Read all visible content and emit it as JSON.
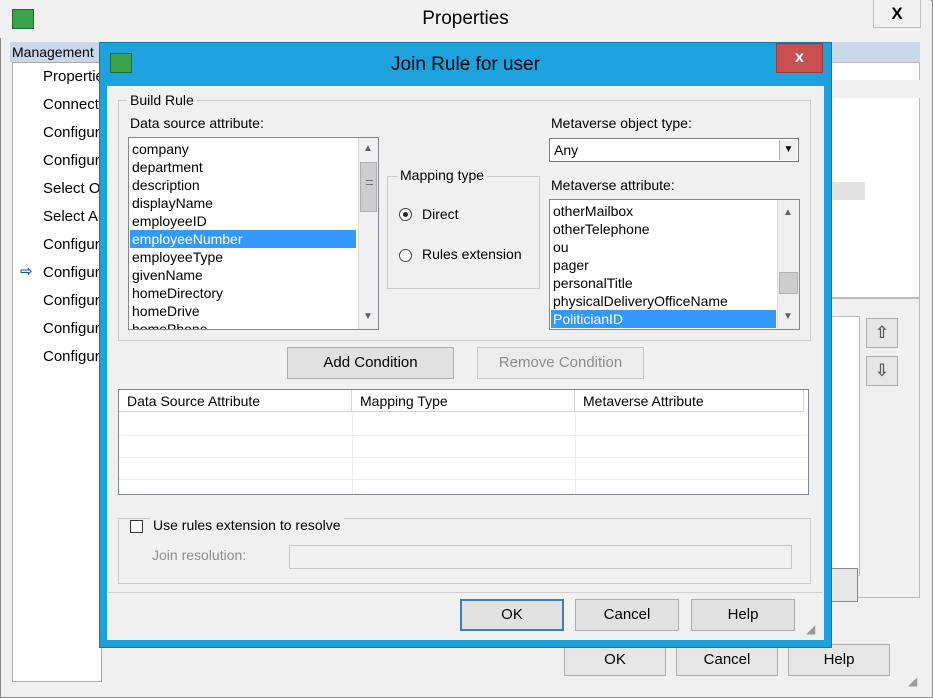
{
  "parent": {
    "title": "Properties",
    "close_glyph": "X",
    "tab_label": "Management",
    "nav_items": [
      "Propertie",
      "Connect",
      "Configur",
      "Configur",
      "Select O",
      "Select A",
      "Configur",
      "Configur",
      "Configur",
      "Configur",
      "Configur"
    ],
    "nav_current_index": 7,
    "current_arrow": "⇨",
    "buttons": {
      "ok": "OK",
      "cancel": "Cancel",
      "help": "Help"
    },
    "up_arrow": "⇧",
    "down_arrow": "⇩"
  },
  "dialog": {
    "title": "Join Rule for user",
    "close_glyph": "x",
    "build_rule": {
      "group_label": "Build Rule",
      "data_source_label": "Data source attribute:",
      "data_source_items": [
        "company",
        "department",
        "description",
        "displayName",
        "employeeID",
        "employeeNumber",
        "employeeType",
        "givenName",
        "homeDirectory",
        "homeDrive",
        "homePhone"
      ],
      "data_source_selected": "employeeNumber",
      "mapping_type": {
        "label": "Mapping type",
        "options": [
          "Direct",
          "Rules extension"
        ],
        "selected": "Direct"
      },
      "metaverse_object_type_label": "Metaverse object type:",
      "metaverse_object_type_value": "Any",
      "metaverse_attribute_label": "Metaverse attribute:",
      "metaverse_items": [
        "otherMailbox",
        "otherTelephone",
        "ou",
        "pager",
        "personalTitle",
        "physicalDeliveryOfficeName",
        "PoliticianID"
      ],
      "metaverse_selected": "PoliticianID"
    },
    "add_condition": "Add Condition",
    "remove_condition": "Remove Condition",
    "table": {
      "columns": [
        "Data Source Attribute",
        "Mapping Type",
        "Metaverse Attribute"
      ],
      "rows": []
    },
    "resolution": {
      "checkbox_label": "Use rules extension to resolve",
      "checked": false,
      "join_resolution_label": "Join resolution:",
      "join_resolution_value": ""
    },
    "buttons": {
      "ok": "OK",
      "cancel": "Cancel",
      "help": "Help"
    }
  }
}
